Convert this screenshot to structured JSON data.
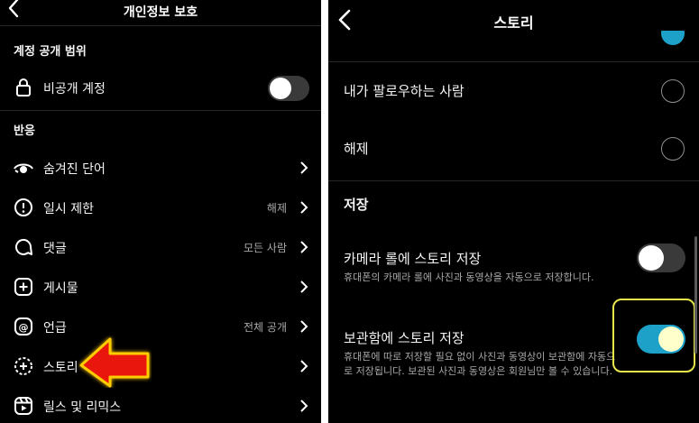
{
  "left": {
    "title": "개인정보 보호",
    "account_section": "계정 공개 범위",
    "private_account_label": "비공개 계정",
    "private_account_on": false,
    "reaction_section": "반응",
    "items": [
      {
        "label": "숨겨진 단어",
        "value": "",
        "icon": "eye-icon"
      },
      {
        "label": "일시 제한",
        "value": "해제",
        "icon": "alert-circle-icon"
      },
      {
        "label": "댓글",
        "value": "모든 사람",
        "icon": "comment-icon"
      },
      {
        "label": "게시물",
        "value": "",
        "icon": "plus-square-icon"
      },
      {
        "label": "언급",
        "value": "전체 공개",
        "icon": "at-icon"
      },
      {
        "label": "스토리",
        "value": "",
        "icon": "story-plus-icon"
      },
      {
        "label": "릴스 및 리믹스",
        "value": "",
        "icon": "reels-icon"
      }
    ],
    "arrow_color": "#e8140c"
  },
  "right": {
    "title": "스토리",
    "reply_options": [
      {
        "label": "내가 팔로우하는 사람",
        "selected": false
      },
      {
        "label": "해제",
        "selected": false
      }
    ],
    "save_section": "저장",
    "camera_roll": {
      "label": "카메라 롤에 스토리 저장",
      "description": "휴대폰의 카메라 롤에 사진과 동영상을 자동으로 저장합니다.",
      "on": false
    },
    "archive": {
      "label": "보관함에 스토리 저장",
      "description": "휴대폰에 따로 저장할 필요 없이 사진과 동영상이 보관함에 자동으로 저장됩니다. 보관된 사진과 동영상은 회원님만 볼 수 있습니다.",
      "on": true
    },
    "accent": "#1da1c8",
    "highlight_color": "#e8e84a"
  }
}
